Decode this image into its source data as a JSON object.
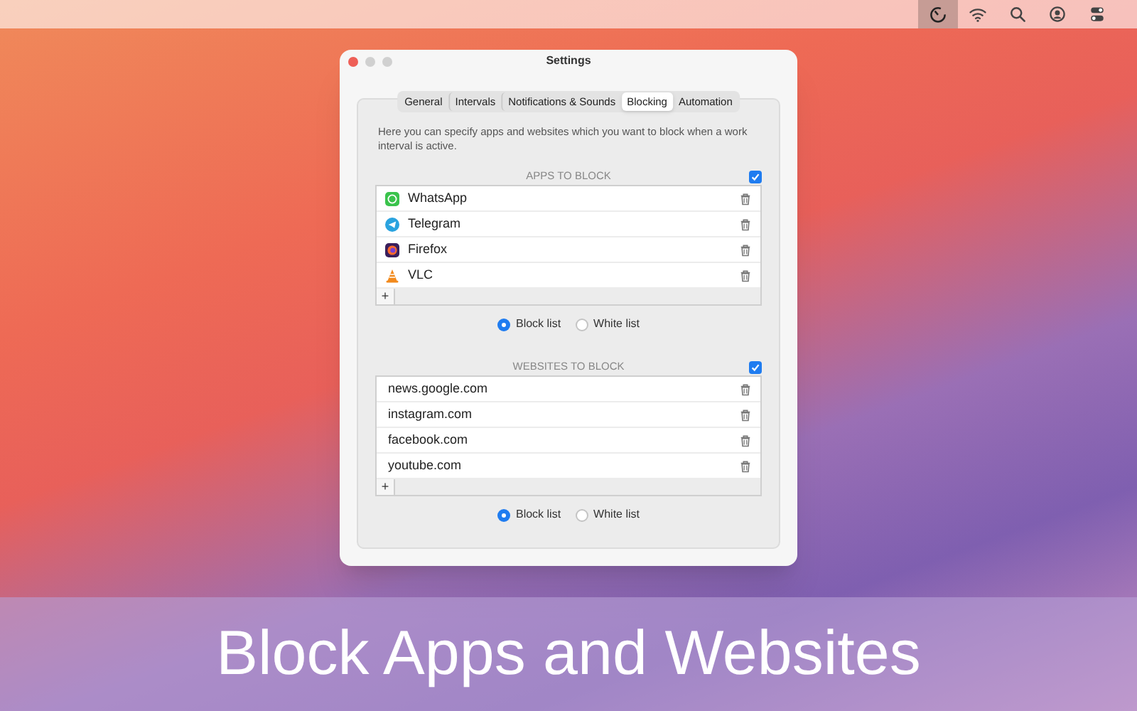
{
  "menu_bar": {
    "icons": [
      {
        "kind": "timer",
        "selected": true
      },
      {
        "kind": "wifi",
        "selected": false
      },
      {
        "kind": "search",
        "selected": false
      },
      {
        "kind": "user",
        "selected": false
      },
      {
        "kind": "toggles",
        "selected": false
      }
    ]
  },
  "window": {
    "title": "Settings",
    "tabs": [
      {
        "label": "General",
        "selected": false
      },
      {
        "label": "Intervals",
        "selected": false
      },
      {
        "label": "Notifications & Sounds",
        "selected": false
      },
      {
        "label": "Blocking",
        "selected": true
      },
      {
        "label": "Automation",
        "selected": false
      }
    ],
    "description": "Here you can specify apps and websites which you want to block when a work interval is active.",
    "sections": [
      {
        "title": "APPS TO BLOCK",
        "checked": true,
        "items": [
          {
            "kind": "whatsapp",
            "label": "WhatsApp"
          },
          {
            "kind": "telegram",
            "label": "Telegram"
          },
          {
            "kind": "firefox",
            "label": "Firefox"
          },
          {
            "kind": "vlc",
            "label": "VLC"
          }
        ],
        "add": "+",
        "modes": [
          {
            "label": "Block list",
            "selected": true
          },
          {
            "label": "White list",
            "selected": false
          }
        ]
      },
      {
        "title": "WEBSITES TO BLOCK",
        "checked": true,
        "items": [
          {
            "kind": "website",
            "label": "news.google.com"
          },
          {
            "kind": "website",
            "label": "instagram.com"
          },
          {
            "kind": "website",
            "label": "facebook.com"
          },
          {
            "kind": "website",
            "label": "youtube.com"
          }
        ],
        "add": "+",
        "modes": [
          {
            "label": "Block list",
            "selected": true
          },
          {
            "label": "White list",
            "selected": false
          }
        ]
      }
    ]
  },
  "caption": "Block Apps and Websites"
}
